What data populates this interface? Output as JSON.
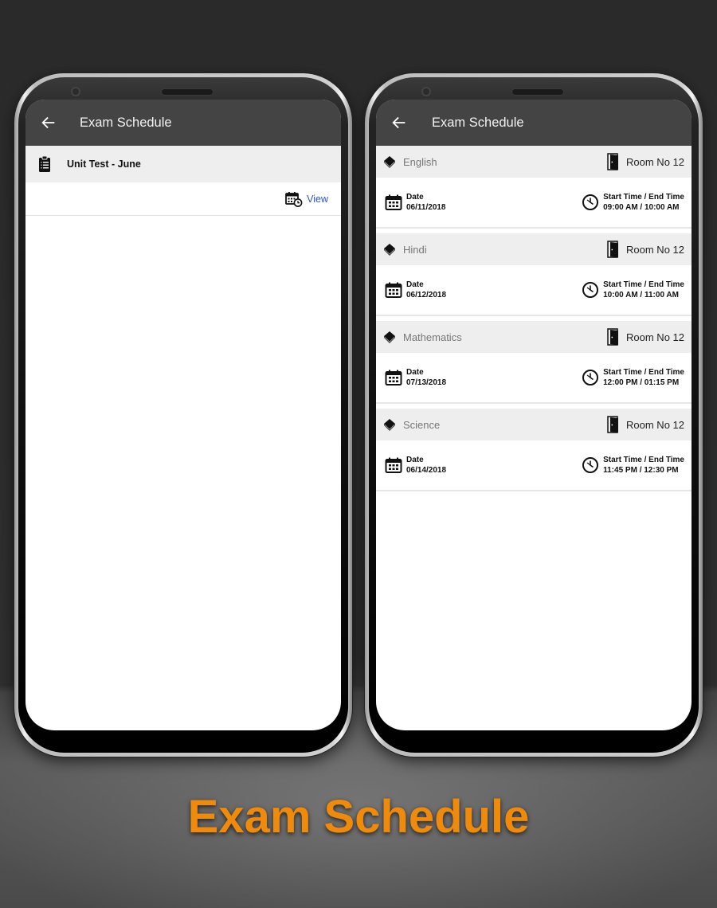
{
  "left_phone": {
    "appbar": {
      "title": "Exam Schedule",
      "back_icon": "arrow-left-icon"
    },
    "exam": {
      "icon": "clipboard-list-icon",
      "name": "Unit Test - June",
      "view_icon": "calendar-clock-icon",
      "view_label": "View"
    }
  },
  "right_phone": {
    "appbar": {
      "title": "Exam Schedule",
      "back_icon": "arrow-left-icon"
    },
    "labels": {
      "date": "Date",
      "time": "Start Time / End Time",
      "room_prefix": "Room No"
    },
    "exams": [
      {
        "subject": "English",
        "room": "Room No  12",
        "date": "06/11/2018",
        "time": "09:00 AM / 10:00 AM"
      },
      {
        "subject": "Hindi",
        "room": "Room No  12",
        "date": "06/12/2018",
        "time": "10:00 AM / 11:00 AM"
      },
      {
        "subject": "Mathematics",
        "room": "Room No  12",
        "date": "07/13/2018",
        "time": "12:00 PM / 01:15 PM"
      },
      {
        "subject": "Science",
        "room": "Room No  12",
        "date": "06/14/2018",
        "time": "11:45 PM / 12:30 PM"
      }
    ]
  },
  "banner": {
    "title": "Exam Schedule",
    "color": "#f08a0a"
  },
  "colors": {
    "appbar": "#444444",
    "link": "#2f54c4",
    "row_bg": "#eeeeee"
  }
}
